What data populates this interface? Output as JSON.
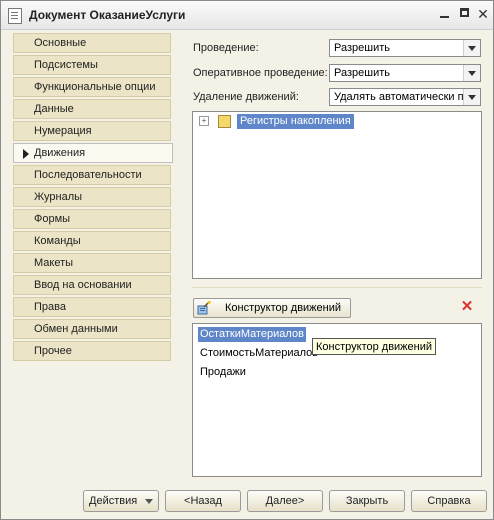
{
  "window": {
    "title": "Документ ОказаниеУслуги"
  },
  "sidebar": {
    "items": [
      {
        "label": "Основные"
      },
      {
        "label": "Подсистемы"
      },
      {
        "label": "Функциональные опции"
      },
      {
        "label": "Данные"
      },
      {
        "label": "Нумерация"
      },
      {
        "label": "Движения"
      },
      {
        "label": "Последовательности"
      },
      {
        "label": "Журналы"
      },
      {
        "label": "Формы"
      },
      {
        "label": "Команды"
      },
      {
        "label": "Макеты"
      },
      {
        "label": "Ввод на основании"
      },
      {
        "label": "Права"
      },
      {
        "label": "Обмен данными"
      },
      {
        "label": "Прочее"
      }
    ],
    "active": "Движения"
  },
  "form": {
    "posting_label": "Проведение:",
    "posting_value": "Разрешить",
    "realtime_posting_label": "Оперативное проведение:",
    "realtime_posting_value": "Разрешить",
    "delete_movements_label": "Удаление движений:",
    "delete_movements_value": "Удалять автоматически п"
  },
  "tree": {
    "expander": "+",
    "root_label": "Регистры накопления"
  },
  "constructor": {
    "button_label": "Конструктор движений",
    "delete_icon": "delete-x-icon"
  },
  "registers": {
    "items": [
      "ОстаткиМатериалов",
      "СтоимостьМатериалов",
      "Продажи"
    ],
    "selected": "ОстаткиМатериалов"
  },
  "tooltip": {
    "text": "Конструктор движений"
  },
  "buttons": {
    "actions": "Действия",
    "back": "<Назад",
    "next": "Далее>",
    "close": "Закрыть",
    "help": "Справка"
  },
  "colors": {
    "selection": "#5f86c8",
    "nav_tab": "#ebe4c6",
    "window_bg": "#f4f1e6",
    "delete": "#dd3333"
  }
}
